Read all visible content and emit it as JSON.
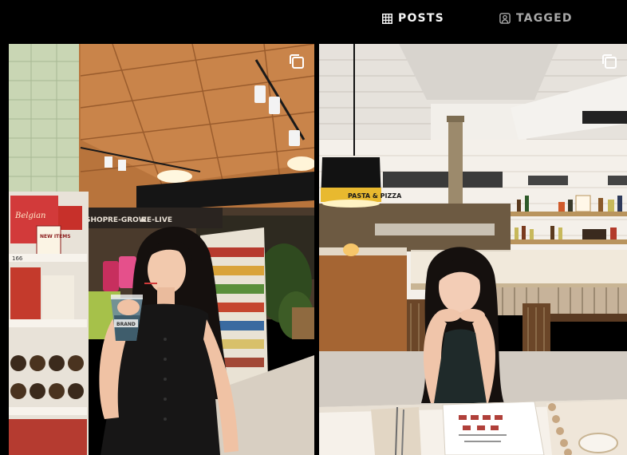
{
  "tabs": [
    {
      "label": "POSTS",
      "icon": "grid-icon",
      "active": true
    },
    {
      "label": "TAGGED",
      "icon": "tagged-icon",
      "active": false
    }
  ],
  "posts": [
    {
      "type": "carousel",
      "icon": "multiple-photos-icon",
      "signs": {
        "shop": "SHOP",
        "regrow": "RE-GROW",
        "relive": "RE-LIVE",
        "belgian": "Belgian",
        "new_items": "NEW ITEMS",
        "price": "166",
        "cup_brand": "BRAND"
      }
    },
    {
      "type": "carousel",
      "icon": "multiple-photos-icon",
      "signs": {
        "lamp": "PASTA & PIZZA"
      }
    }
  ],
  "colors": {
    "background": "#000000",
    "tab_active": "#f5f5f5",
    "tab_inactive": "#a8a8a8"
  }
}
